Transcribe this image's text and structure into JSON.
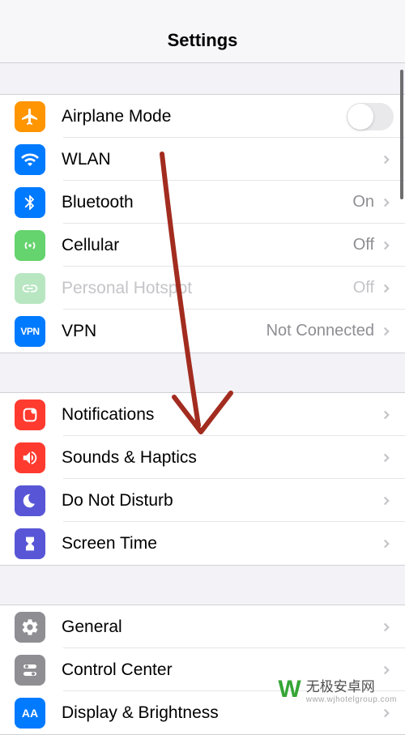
{
  "header": {
    "title": "Settings"
  },
  "group1": {
    "airplane": {
      "label": "Airplane Mode",
      "icon_bg": "#ff9501"
    },
    "wlan": {
      "label": "WLAN",
      "icon_bg": "#007aff"
    },
    "bluetooth": {
      "label": "Bluetooth",
      "value": "On",
      "icon_bg": "#007aff"
    },
    "cellular": {
      "label": "Cellular",
      "value": "Off",
      "icon_bg": "#65d36e"
    },
    "hotspot": {
      "label": "Personal Hotspot",
      "value": "Off",
      "icon_bg": "#b8e6c1"
    },
    "vpn": {
      "label": "VPN",
      "value": "Not Connected",
      "icon_text": "VPN",
      "icon_bg": "#007aff"
    }
  },
  "group2": {
    "notifications": {
      "label": "Notifications",
      "icon_bg": "#ff3b30"
    },
    "sounds": {
      "label": "Sounds & Haptics",
      "icon_bg": "#ff3b30"
    },
    "dnd": {
      "label": "Do Not Disturb",
      "icon_bg": "#5856d6"
    },
    "screentime": {
      "label": "Screen Time",
      "icon_bg": "#5856d6"
    }
  },
  "group3": {
    "general": {
      "label": "General",
      "icon_bg": "#8e8e93"
    },
    "controlcenter": {
      "label": "Control Center",
      "icon_bg": "#8e8e93"
    },
    "display": {
      "label": "Display & Brightness",
      "icon_text": "AA",
      "icon_bg": "#007aff"
    }
  },
  "watermark": {
    "brand": "无极安卓网",
    "url": "www.wjhotelgroup.com"
  }
}
